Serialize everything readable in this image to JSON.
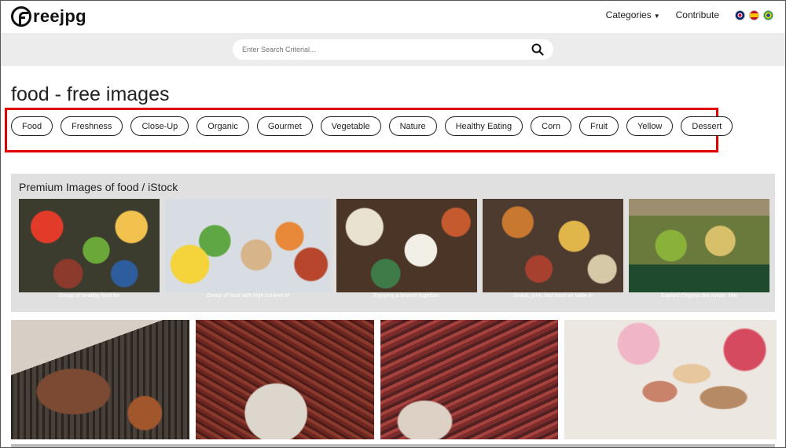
{
  "header": {
    "logo_text": "reejpg",
    "nav": [
      {
        "label": "Categories",
        "has_caret": true
      },
      {
        "label": "Contribute",
        "has_caret": false
      }
    ],
    "flags": [
      "uk-flag-icon",
      "es-flag-icon",
      "br-flag-icon"
    ]
  },
  "search": {
    "placeholder": "Enter Search Criterial..."
  },
  "page_title": "food - free images",
  "tags": [
    "Food",
    "Freshness",
    "Close-Up",
    "Organic",
    "Gourmet",
    "Vegetable",
    "Nature",
    "Healthy Eating",
    "Corn",
    "Fruit",
    "Yellow",
    "Dessert"
  ],
  "premium": {
    "title": "Premium Images of food / iStock",
    "items": [
      {
        "caption": "Group of healthy food for"
      },
      {
        "caption": "Group of food with high content of"
      },
      {
        "caption": "Enjoying a brunch together."
      },
      {
        "caption": "Snack, junk, fast food on table in"
      },
      {
        "caption": "Expired Organic bio waste. Mat"
      }
    ]
  },
  "colors": {
    "highlight_border": "#e00000",
    "search_band": "#ececec",
    "premium_bg": "#e0e0e0"
  }
}
